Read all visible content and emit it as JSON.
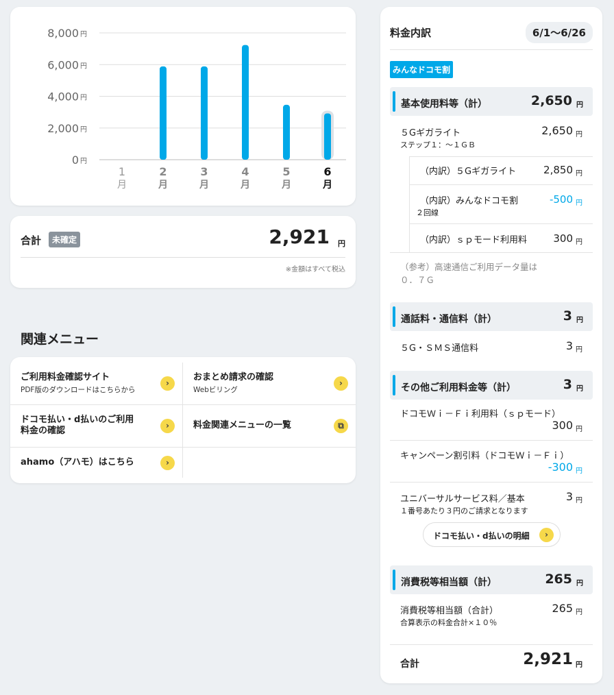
{
  "chart_data": {
    "type": "bar",
    "categories": [
      "1月",
      "2月",
      "3月",
      "4月",
      "5月",
      "6月"
    ],
    "values": [
      0,
      5889,
      5889,
      7238,
      3464,
      2921
    ],
    "y_ticks": [
      "8,000",
      "6,000",
      "4,000",
      "2,000",
      "0"
    ],
    "y_unit": "円",
    "ylim": [
      0,
      8000
    ],
    "selected_month": "6月",
    "bar_color": "#00a8e8",
    "grid": true
  },
  "total_card": {
    "label": "合計",
    "badge": "未確定",
    "amount": "2,921",
    "yen": "円",
    "note": "※金額はすべて税込"
  },
  "related_menu": {
    "title": "関連メニュー",
    "items": [
      {
        "title": "ご利用料金確認サイト",
        "sub": "PDF版のダウンロードはこちらから",
        "icon": "chevron-right-icon"
      },
      {
        "title": "おまとめ請求の確認",
        "sub": "Webビリング",
        "icon": "chevron-right-icon"
      },
      {
        "title": "ドコモ払い・d払いのご利用",
        "title2": "料金の確認",
        "icon": "chevron-right-icon"
      },
      {
        "title": "料金関連メニューの一覧",
        "icon": "external-window-icon"
      },
      {
        "title": "ahamo（アハモ）はこちら",
        "icon": "chevron-right-icon"
      }
    ]
  },
  "breakdown": {
    "title": "料金内訳",
    "period": "6/1〜6/26",
    "plan_badge": "みんなドコモ割",
    "yen": "円",
    "sections": {
      "basic": {
        "label": "基本使用料等（計）",
        "amount": "2,650"
      },
      "call": {
        "label": "通話料・通信料（計）",
        "amount": "3"
      },
      "other": {
        "label": "その他ご利用料金等（計）",
        "amount": "3"
      },
      "tax": {
        "label": "消費税等相当額（計）",
        "amount": "265"
      }
    },
    "rows": {
      "giga_lite": {
        "label": "５Gギガライト",
        "sub": "ステップ１：〜１ＧＢ",
        "amount": "2,650"
      },
      "inner_giga": {
        "label": "（内訳）５Gギガライト",
        "amount": "2,850"
      },
      "inner_docomo": {
        "label": "（内訳）みんなドコモ割",
        "sub": "２回線",
        "amount": "-500"
      },
      "inner_sp": {
        "label": "（内訳）ｓｐモード利用料",
        "amount": "300"
      },
      "data_note_1": "（参考）高速通信ご利用データ量は",
      "data_note_2": "０．７Ｇ",
      "sms": {
        "label": "５G・ＳＭＳ通信料",
        "amount": "3"
      },
      "wifi": {
        "label": "ドコモＷｉ－Ｆｉ利用料（ｓｐモード）",
        "amount": "300"
      },
      "campaign": {
        "label": "キャンペーン割引料（ドコモＷｉ－Ｆｉ）",
        "amount": "-300"
      },
      "universal": {
        "label": "ユニバーサルサービス料／基本",
        "sub": "１番号あたり３円のご請求となります",
        "amount": "3"
      },
      "tax_total": {
        "label": "消費税等相当額（合計）",
        "sub": "合算表示の料金合計×１０％",
        "amount": "265"
      }
    },
    "pay_button": "ドコモ払い・d払いの明細",
    "total_label": "合計",
    "total_amount": "2,921"
  }
}
